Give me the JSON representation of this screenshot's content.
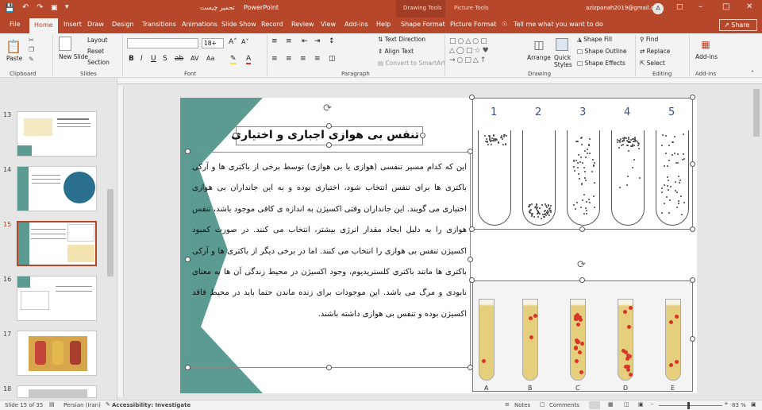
{
  "titlebar": {
    "doc_title": "تحمیر چیست",
    "app_name": "PowerPoint",
    "drawing_tools": "Drawing Tools",
    "picture_tools": "Picture Tools",
    "user_email": "azizpanah2019@gmail.com",
    "avatar": "A"
  },
  "tabs": [
    "File",
    "Home",
    "Insert",
    "Draw",
    "Design",
    "Transitions",
    "Animations",
    "Slide Show",
    "Record",
    "Review",
    "View",
    "Add-ins",
    "Help",
    "Shape Format",
    "Picture Format"
  ],
  "tell_me": "Tell me what you want to do",
  "share": "Share",
  "ribbon": {
    "clipboard": {
      "label": "Clipboard",
      "paste": "Paste"
    },
    "slides": {
      "label": "Slides",
      "new_slide": "New Slide",
      "layout": "Layout",
      "reset": "Reset",
      "section": "Section"
    },
    "font": {
      "label": "Font",
      "font_name": "",
      "font_size": "18+"
    },
    "paragraph": {
      "label": "Paragraph",
      "text_direction": "Text Direction",
      "align_text": "Align Text",
      "smartart": "Convert to SmartArt"
    },
    "drawing": {
      "label": "Drawing",
      "arrange": "Arrange",
      "quick_styles": "Quick Styles",
      "shape_fill": "Shape Fill",
      "shape_outline": "Shape Outline",
      "shape_effects": "Shape Effects"
    },
    "editing": {
      "label": "Editing",
      "find": "Find",
      "replace": "Replace",
      "select": "Select"
    },
    "addins": {
      "label": "Add-ins",
      "addins": "Add-ins"
    }
  },
  "thumbnails": [
    "13",
    "14",
    "15",
    "16",
    "17",
    "18"
  ],
  "slide": {
    "title": "تنفس بی هوازی اجباری و اختیاری",
    "body": "این که کدام مسیر تنفسی (هوازی یا بی هوازی) توسط برخی از باکتری ها و آرکی باکتری ها برای تنفس انتخاب شود، اختیاری بوده و به این جانداران بی هوازی اختیاری می گویند. این جانداران وقتی اکسیژن به اندازه ی کافی موجود باشد، تنفس هوازی را به دلیل ایجاد مقدار انرژی بیشتر، انتخاب می کنند. در صورت کمبود اکسیژن تنفس بی هوازی را انتخاب می کنند. اما در برخی دیگر از باکتری ها و آرکی باکتری ها مانند باکتری کلستریدیوم، وجود اکسیژن در محیط زندگی آن ها به معنای نابودی و مرگ می باشد. این موجودات برای زنده ماندن حتما باید در محیط فاقد اکسیژن بوده و تنفس بی هوازی داشته باشند.",
    "tube_labels": [
      "1",
      "2",
      "3",
      "4",
      "5"
    ],
    "vial_labels": [
      "A",
      "B",
      "C",
      "D",
      "E"
    ]
  },
  "status": {
    "slide_of": "Slide 15 of 35",
    "language": "Persian (Iran)",
    "accessibility": "Accessibility: Investigate",
    "notes": "Notes",
    "comments": "Comments",
    "zoom": "83 %"
  },
  "colors": {
    "accent": "#b7472a",
    "slide_teal": "#5b9b91"
  }
}
